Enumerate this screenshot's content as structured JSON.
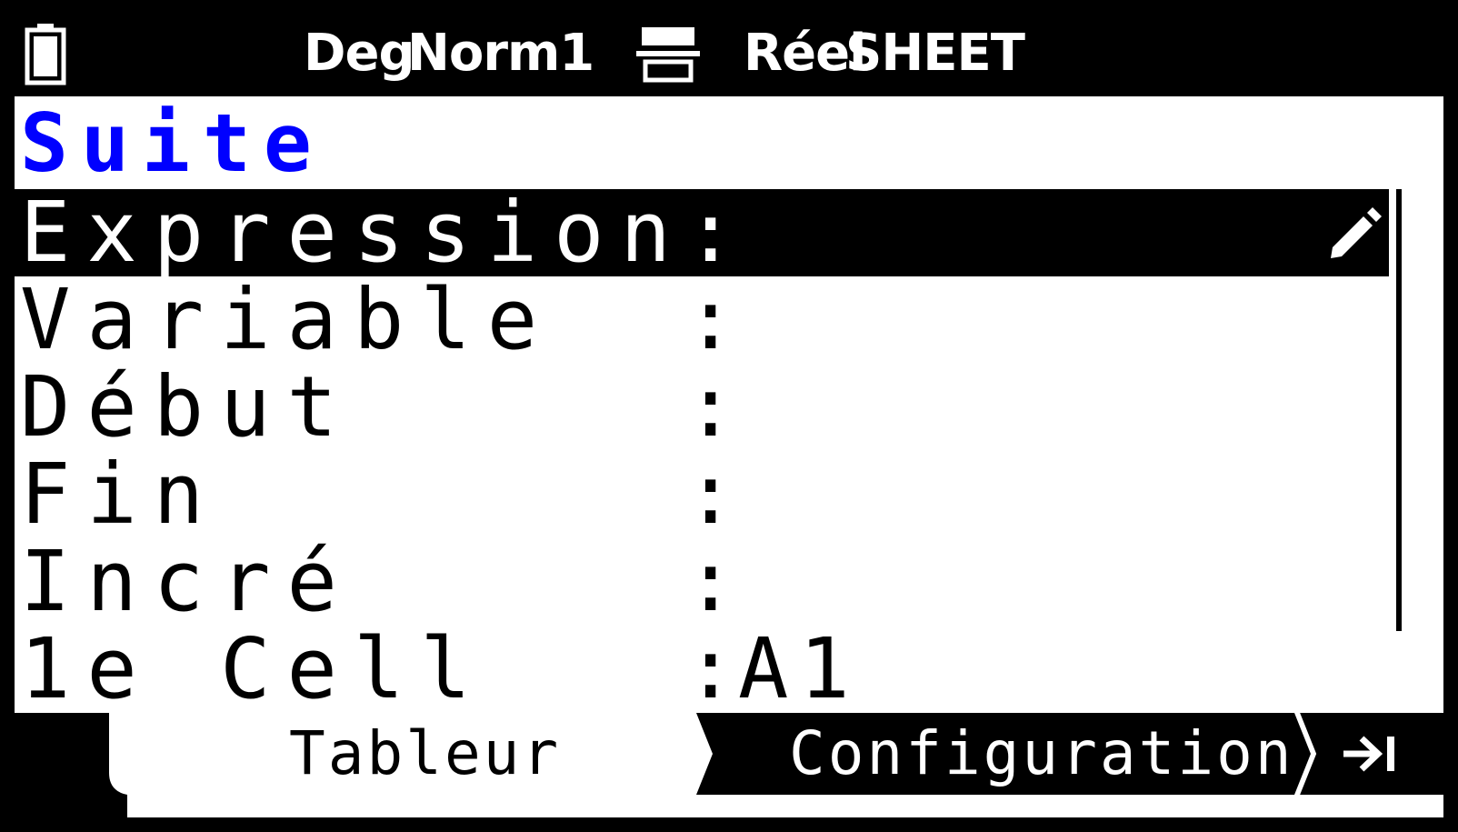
{
  "status_bar": {
    "angle": "Deg",
    "display": "Norm1",
    "mode": "Réel",
    "app": "SHEET",
    "battery_icon": "battery-icon",
    "io_icon": "input-output-icon"
  },
  "title": "Suite",
  "settings": [
    {
      "label": "Expression",
      "value": "",
      "selected": true
    },
    {
      "label": "Variable",
      "value": ""
    },
    {
      "label": "Début",
      "value": ""
    },
    {
      "label": "Fin",
      "value": ""
    },
    {
      "label": "Incré",
      "value": ""
    },
    {
      "label": "1e Cell",
      "value": "A1"
    }
  ],
  "separator": ":",
  "tabs": [
    {
      "label": "Tableur",
      "active": true
    },
    {
      "label": "Configuration",
      "active": false
    }
  ],
  "edit_icon": "pencil-icon",
  "end_icon": "jump-to-end-icon",
  "colors": {
    "title": "#0000ff",
    "selection": "#000000",
    "background": "#ffffff"
  }
}
